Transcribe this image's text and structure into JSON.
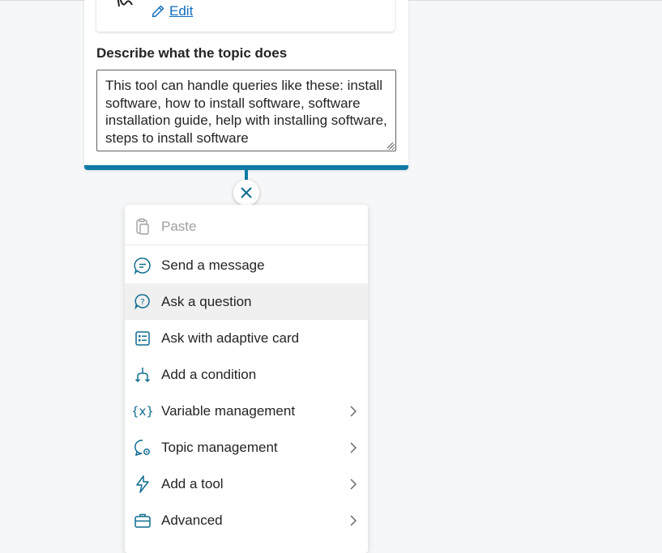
{
  "trigger": {
    "edit_label": "Edit",
    "describe_label": "Describe what the topic does",
    "describe_text": "This tool can handle queries like these: install software, how to install software, software installation guide, help with installing software, steps to install software"
  },
  "menu": {
    "paste": "Paste",
    "items": [
      {
        "label": "Send a message",
        "icon": "chat-bubble-icon"
      },
      {
        "label": "Ask a question",
        "icon": "question-bubble-icon"
      },
      {
        "label": "Ask with adaptive card",
        "icon": "adaptive-card-icon"
      },
      {
        "label": "Add a condition",
        "icon": "branch-icon"
      },
      {
        "label": "Variable management",
        "icon": "variable-icon"
      },
      {
        "label": "Topic management",
        "icon": "topic-gear-icon"
      },
      {
        "label": "Add a tool",
        "icon": "lightning-icon"
      },
      {
        "label": "Advanced",
        "icon": "briefcase-icon"
      }
    ]
  },
  "colors": {
    "accent": "#0f7ba5",
    "icon": "#0f6c8f",
    "link": "#0f6cbd"
  }
}
